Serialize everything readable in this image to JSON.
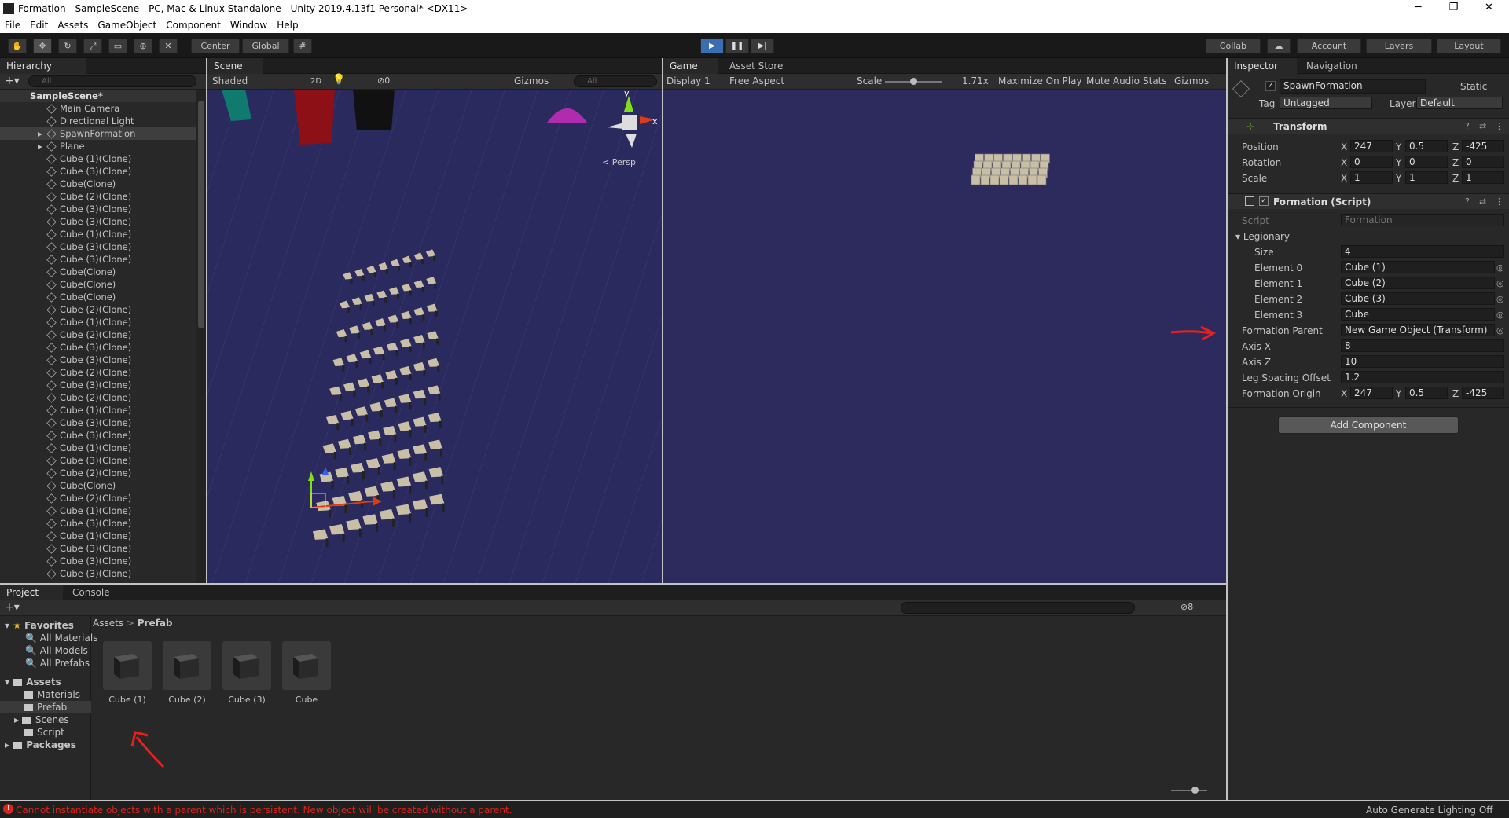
{
  "window": {
    "title": "Formation - SampleScene - PC, Mac & Linux Standalone - Unity 2019.4.13f1 Personal* <DX11>"
  },
  "menu": [
    "File",
    "Edit",
    "Assets",
    "GameObject",
    "Component",
    "Window",
    "Help"
  ],
  "toolbar": {
    "center": "Center",
    "global": "Global",
    "collab": "Collab",
    "account": "Account",
    "layers": "Layers",
    "layout": "Layout"
  },
  "hierarchy": {
    "tab": "Hierarchy",
    "search_placeholder": "All",
    "scene": "SampleScene*",
    "items": [
      "Main Camera",
      "Directional Light",
      "SpawnFormation",
      "Plane",
      "Cube (1)(Clone)",
      "Cube (3)(Clone)",
      "Cube(Clone)",
      "Cube (2)(Clone)",
      "Cube (3)(Clone)",
      "Cube (3)(Clone)",
      "Cube (1)(Clone)",
      "Cube (3)(Clone)",
      "Cube (3)(Clone)",
      "Cube(Clone)",
      "Cube(Clone)",
      "Cube(Clone)",
      "Cube (2)(Clone)",
      "Cube (1)(Clone)",
      "Cube (2)(Clone)",
      "Cube (3)(Clone)",
      "Cube (3)(Clone)",
      "Cube (2)(Clone)",
      "Cube (3)(Clone)",
      "Cube (2)(Clone)",
      "Cube (1)(Clone)",
      "Cube (3)(Clone)",
      "Cube (3)(Clone)",
      "Cube (1)(Clone)",
      "Cube (3)(Clone)",
      "Cube (2)(Clone)",
      "Cube(Clone)",
      "Cube (2)(Clone)",
      "Cube (1)(Clone)",
      "Cube (3)(Clone)",
      "Cube (1)(Clone)",
      "Cube (3)(Clone)",
      "Cube (3)(Clone)",
      "Cube (3)(Clone)"
    ]
  },
  "scene": {
    "tab": "Scene",
    "shading": "Shaded",
    "mode2d": "2D",
    "hidden_count": "0",
    "gizmos": "Gizmos",
    "search_placeholder": "All",
    "persp": "< Persp",
    "axis_y": "y",
    "axis_x": "x"
  },
  "game": {
    "tab": "Game",
    "store_tab": "Asset Store",
    "display": "Display 1",
    "aspect": "Free Aspect",
    "scale_label": "Scale",
    "scale_value": "1.71x",
    "maximize": "Maximize On Play",
    "mute": "Mute Audio",
    "stats": "Stats",
    "gizmos": "Gizmos"
  },
  "inspector": {
    "tab": "Inspector",
    "nav_tab": "Navigation",
    "object_name": "SpawnFormation",
    "static": "Static",
    "tag_label": "Tag",
    "tag": "Untagged",
    "layer_label": "Layer",
    "layer": "Default",
    "transform": {
      "title": "Transform",
      "position": {
        "label": "Position",
        "x": "247",
        "y": "0.5",
        "z": "-425"
      },
      "rotation": {
        "label": "Rotation",
        "x": "0",
        "y": "0",
        "z": "0"
      },
      "scale": {
        "label": "Scale",
        "x": "1",
        "y": "1",
        "z": "1"
      }
    },
    "formation": {
      "title": "Formation (Script)",
      "script_label": "Script",
      "script": "Formation",
      "legionary": "Legionary",
      "size_label": "Size",
      "size": "4",
      "elements": [
        {
          "label": "Element 0",
          "value": "Cube (1)"
        },
        {
          "label": "Element 1",
          "value": "Cube (2)"
        },
        {
          "label": "Element 2",
          "value": "Cube (3)"
        },
        {
          "label": "Element 3",
          "value": "Cube"
        }
      ],
      "parent_label": "Formation Parent",
      "parent": "New Game Object (Transform)",
      "axis_x_label": "Axis X",
      "axis_x": "8",
      "axis_z_label": "Axis Z",
      "axis_z": "10",
      "leg_label": "Leg Spacing Offset",
      "leg": "1.2",
      "origin_label": "Formation Origin",
      "origin": {
        "x": "247",
        "y": "0.5",
        "z": "-425"
      }
    },
    "add_component": "Add Component"
  },
  "project": {
    "tab": "Project",
    "console_tab": "Console",
    "badge": "8",
    "favorites": "Favorites",
    "fav_items": [
      "All Materials",
      "All Models",
      "All Prefabs"
    ],
    "assets": "Assets",
    "folders": [
      "Materials",
      "Prefab",
      "Scenes",
      "Script"
    ],
    "packages": "Packages",
    "breadcrumb": [
      "Assets",
      "Prefab"
    ],
    "prefabs": [
      "Cube (1)",
      "Cube (2)",
      "Cube (3)",
      "Cube"
    ]
  },
  "status": {
    "error": "Cannot instantiate objects with a parent which is persistent. New object will be created without a parent.",
    "lighting": "Auto Generate Lighting Off"
  },
  "colors": {
    "scene_bg": "#2b2a5e",
    "game_bg": "#2d2a5e",
    "cube": "#c8bfa6",
    "annotation": "#e8201c",
    "play_accent": "#3b6db1"
  }
}
